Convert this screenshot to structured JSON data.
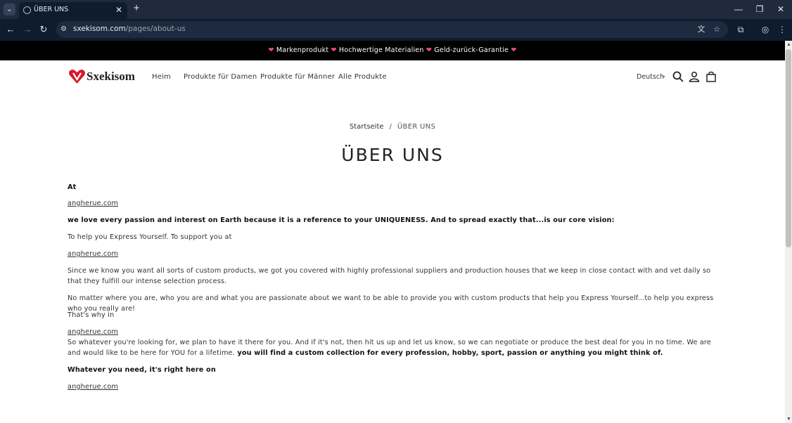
{
  "browser": {
    "tab_title": "ÜBER UNS",
    "url_host": "sxekisom.com",
    "url_path": "/pages/about-us",
    "icons": [
      "tab-list-icon",
      "globe-icon",
      "close-icon",
      "plus-icon",
      "minimize-icon",
      "restore-icon",
      "window-close-icon",
      "back-icon",
      "forward-icon",
      "reload-icon",
      "site-settings-icon",
      "translate-icon",
      "star-icon",
      "extensions-icon",
      "profile-icon",
      "menu-icon"
    ]
  },
  "announcement": {
    "items": [
      "Markenprodukt",
      "Hochwertige Materialien",
      "Geld-zurück-Garantie"
    ],
    "heart": "❤"
  },
  "header": {
    "logo_text": "Sxekisom",
    "nav": [
      "Heim",
      "Produkte für Damen",
      "Produkte für Männer",
      "Alle Produkte"
    ],
    "language": "Deutsch"
  },
  "breadcrumb": {
    "home": "Startseite",
    "separator": "/",
    "current": "ÜBER UNS"
  },
  "page_title": "ÜBER UNS",
  "content": {
    "p1": "At",
    "link": "angherue.com",
    "p2": " we love every passion and interest on Earth because it is a reference to your UNIQUENESS. And to spread exactly that...is our core vision:",
    "p3": "To help you Express Yourself. To support you at",
    "p4": "Since we know you want all sorts of custom products, we got you covered with highly professional suppliers and production houses that we keep in close contact with and vet daily so that they fulfill our intense selection process.",
    "p5": "No matter where you are, who you are and what you are passionate about we want to be able to provide you with custom products that help you Express Yourself...to help you express who you really are!",
    "p6": "That's why in",
    "p7a": "So whatever you're looking for, we plan to have it there for you. And if it's not, then hit us up and let us know, so we can negotiate or produce the best deal for you in no time. We are and would like to be here for YOU for a lifetime.",
    "p7b": " you will find a custom collection for every profession, hobby, sport, passion or anything you might think of.",
    "p8": "Whatever you need, it's right here on"
  },
  "colors": {
    "chrome_dark": "#0f1c2f",
    "tabbar": "#1f2b3d",
    "announcement_bg": "#000000",
    "heart": "#e8536b",
    "logo_red": "#d7192b"
  }
}
